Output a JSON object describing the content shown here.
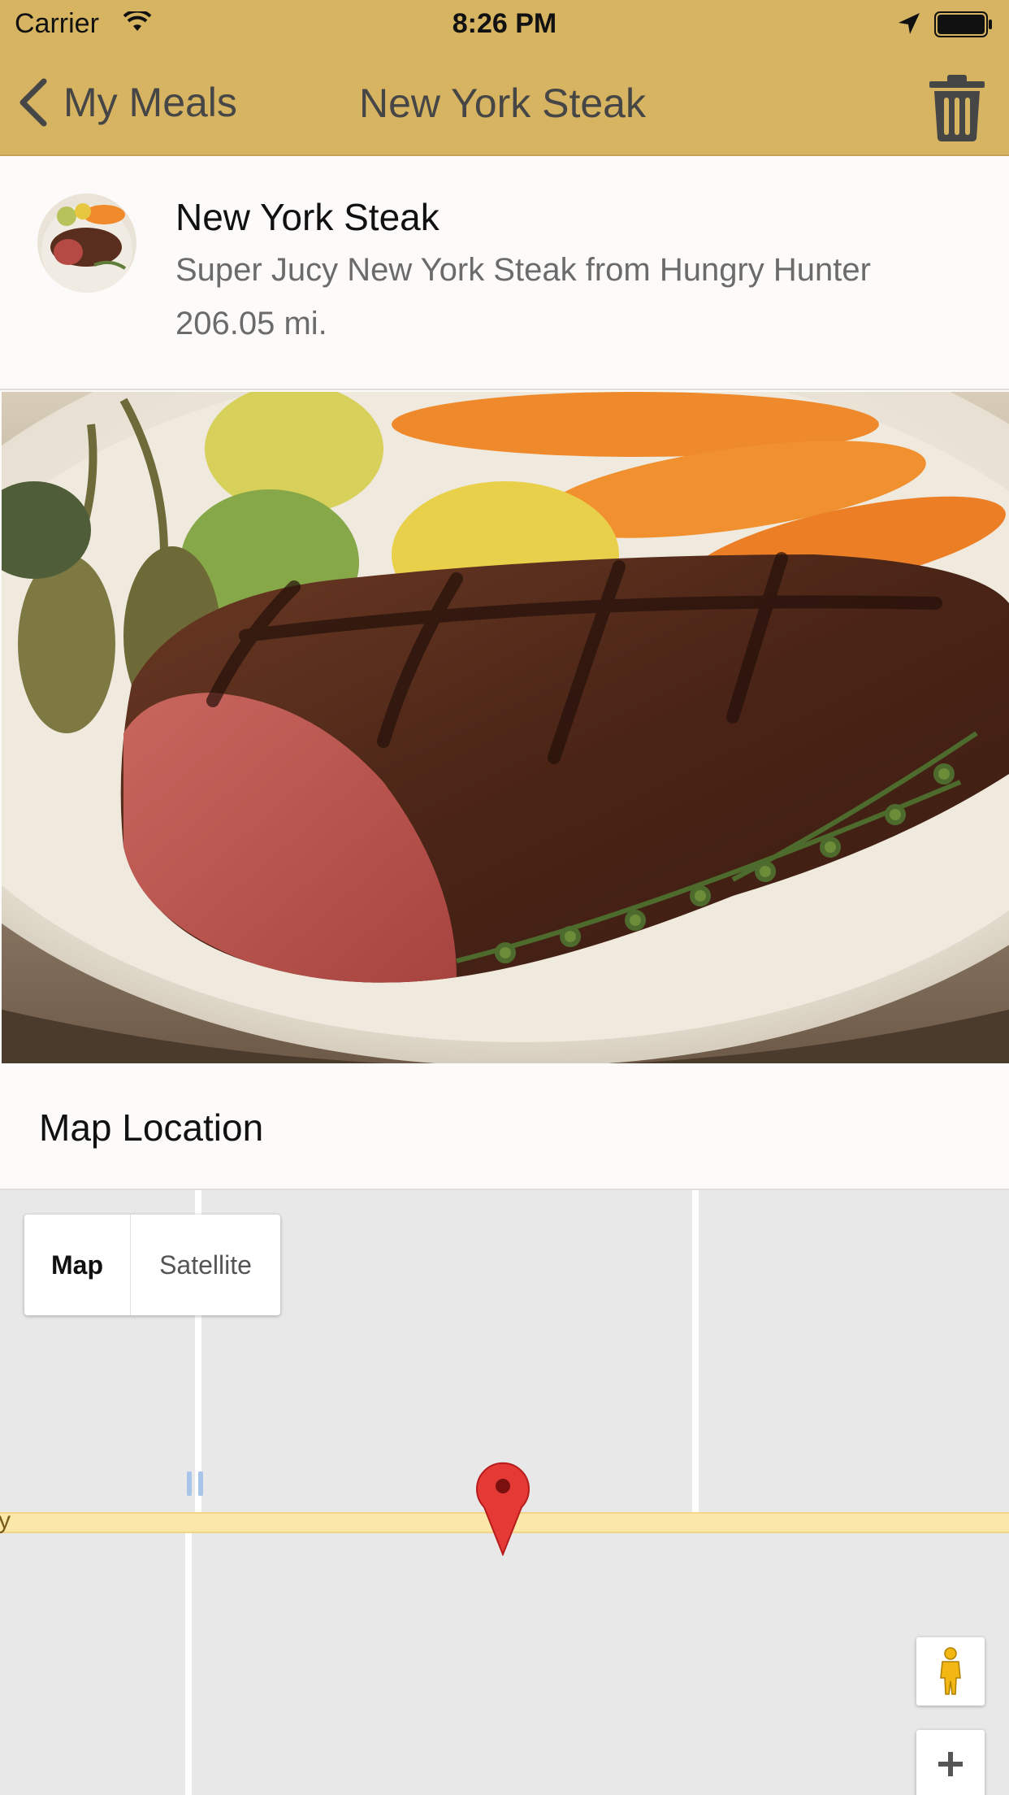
{
  "status_bar": {
    "carrier": "Carrier",
    "time": "8:26 PM"
  },
  "nav": {
    "back_label": "My Meals",
    "title": "New York Steak"
  },
  "meal": {
    "title": "New York Steak",
    "description": "Super Jucy New York Steak from Hungry Hunter",
    "distance": "206.05 mi."
  },
  "map_section": {
    "label": "Map Location",
    "type_map": "Map",
    "type_satellite": "Satellite",
    "road_label_fragment": "y"
  },
  "colors": {
    "header_bg": "#d6b462",
    "road": "#fbe7a8",
    "pin": "#e53935"
  }
}
